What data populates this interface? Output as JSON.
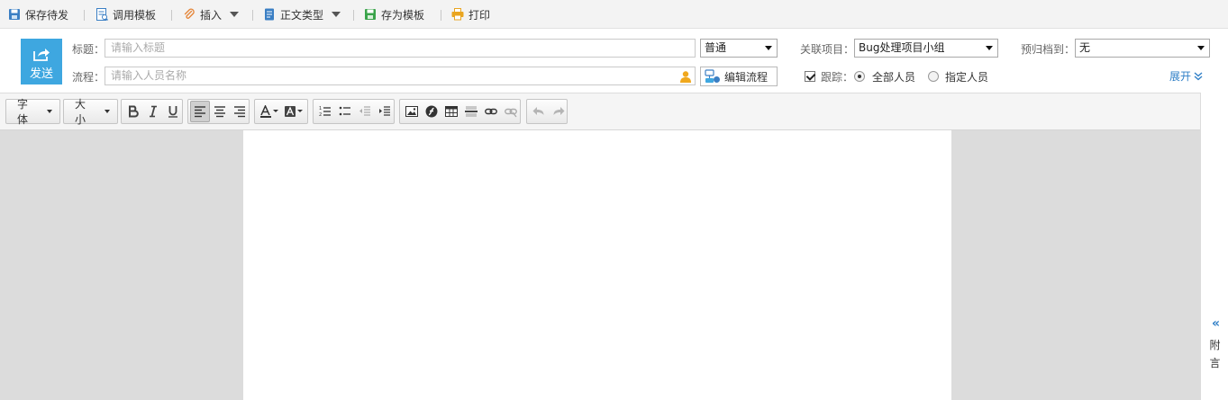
{
  "toolbar": {
    "save_draft": "保存待发",
    "use_template": "调用模板",
    "insert": "插入",
    "body_type": "正文类型",
    "save_as_template": "存为模板",
    "print": "打印"
  },
  "form": {
    "send_label": "发送",
    "title_label": "标题：",
    "title_placeholder": "请输入标题",
    "priority_value": "普通",
    "related_project_label": "关联项目：",
    "related_project_value": "Bug处理项目小组",
    "archive_label": "预归档到：",
    "archive_value": "无",
    "flow_label": "流程：",
    "flow_placeholder": "请输入人员名称",
    "edit_flow_label": "编辑流程",
    "track_label": "跟踪：",
    "track_all_label": "全部人员",
    "track_specified_label": "指定人员",
    "track_checked": true,
    "track_selected": "全部人员",
    "expand_label": "展开"
  },
  "editor_toolbar": {
    "font_label": "字体",
    "size_label": "大小",
    "alignment_active": "left"
  },
  "side_panel": {
    "chars": [
      "附",
      "言"
    ]
  },
  "colors": {
    "send_button": "#3ea7e0",
    "link": "#2f7fc7",
    "workarea_bg": "#dcdcdc"
  }
}
